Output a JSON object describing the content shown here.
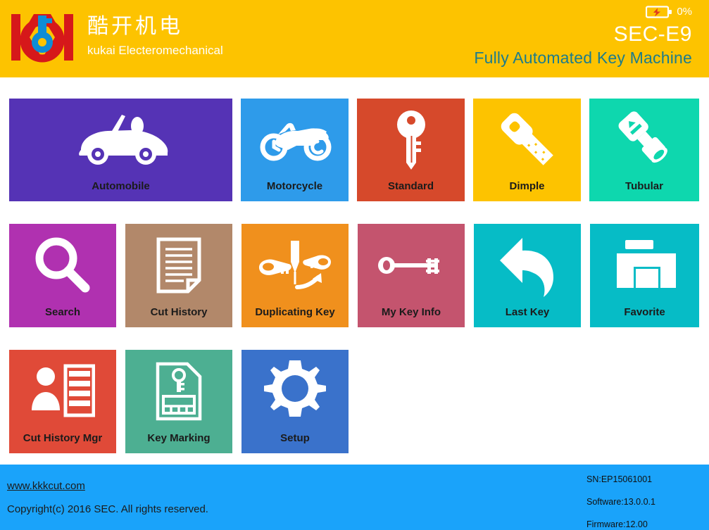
{
  "header": {
    "logo_icon": "kukai-logo-icon",
    "brand_cn": "酷开机电",
    "brand_en": "kukai Electeromechanical",
    "battery_icon": "battery-charging-icon",
    "battery_percent": "0%",
    "model_title": "SEC-E9",
    "model_subtitle": "Fully Automated Key Machine",
    "background_color": "#FDC300",
    "subtitle_color": "#1C7C8C"
  },
  "tiles": [
    {
      "label": "Automobile",
      "icon": "car-icon",
      "color": "#5533B5"
    },
    {
      "label": "Motorcycle",
      "icon": "motorcycle-icon",
      "color": "#2E9BEA"
    },
    {
      "label": "Standard",
      "icon": "standard-key-icon",
      "color": "#D6492B"
    },
    {
      "label": "Dimple",
      "icon": "dimple-key-icon",
      "color": "#FDC300"
    },
    {
      "label": "Tubular",
      "icon": "tubular-key-icon",
      "color": "#0ED7AE"
    },
    {
      "label": "Search",
      "icon": "magnifier-icon",
      "color": "#B031B0"
    },
    {
      "label": "Cut History",
      "icon": "document-icon",
      "color": "#B2886A"
    },
    {
      "label": "Duplicating Key",
      "icon": "duplicate-key-icon",
      "color": "#F0901D"
    },
    {
      "label": "My Key Info",
      "icon": "skeleton-key-icon",
      "color": "#C4546E"
    },
    {
      "label": "Last Key",
      "icon": "back-arrow-icon",
      "color": "#06BCC6"
    },
    {
      "label": "Favorite",
      "icon": "folder-icon",
      "color": "#06BCC6"
    },
    {
      "label": "Cut History Mgr",
      "icon": "user-list-icon",
      "color": "#E04A38"
    },
    {
      "label": "Key Marking",
      "icon": "sim-key-icon",
      "color": "#4DAF92"
    },
    {
      "label": "Setup",
      "icon": "gear-icon",
      "color": "#3A72CB"
    }
  ],
  "footer": {
    "website": "www.kkkcut.com",
    "copyright": "Copyright(c) 2016 SEC.  All rights reserved.",
    "serial_number": "SN:EP15061001",
    "software_version": "Software:13.0.0.1",
    "firmware_version": "Firmware:12.00",
    "background_color": "#1AA3FA"
  }
}
